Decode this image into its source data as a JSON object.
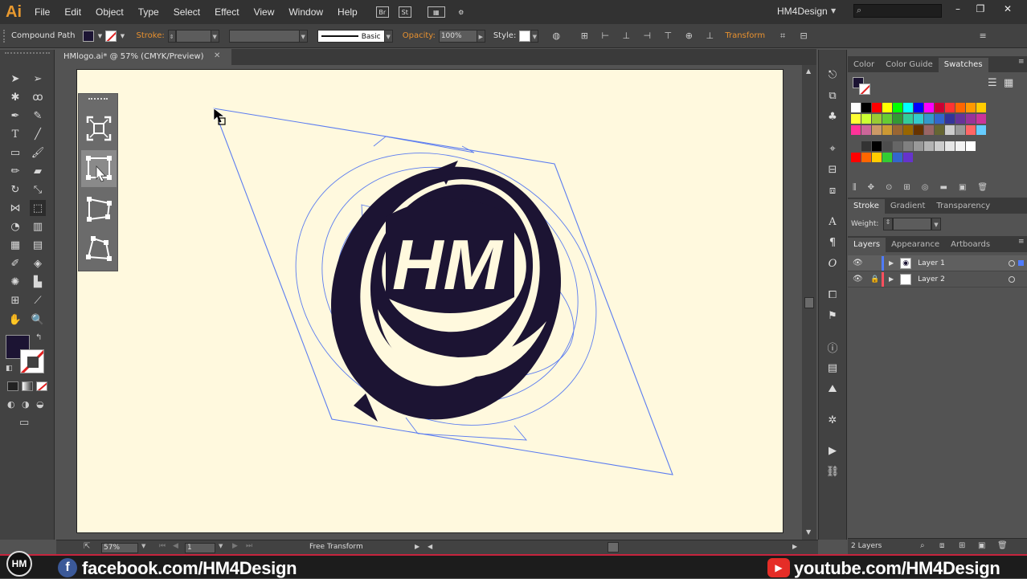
{
  "app": {
    "logo": "Ai"
  },
  "menubar": {
    "items": [
      "File",
      "Edit",
      "Object",
      "Type",
      "Select",
      "Effect",
      "View",
      "Window",
      "Help"
    ],
    "bridge_label": "Br",
    "stock_label": "St",
    "workspace": "HM4Design"
  },
  "controlbar": {
    "selection_type": "Compound Path",
    "stroke_label": "Stroke:",
    "brush_label": "Basic",
    "opacity_label": "Opacity:",
    "opacity_value": "100%",
    "style_label": "Style:",
    "transform_label": "Transform"
  },
  "document": {
    "tab_title": "HMlogo.ai* @ 57% (CMYK/Preview)",
    "logo_text": "HM"
  },
  "statusbar": {
    "zoom": "57%",
    "artboard_number": "1",
    "status_text": "Free Transform"
  },
  "panels": {
    "top_tabs": [
      "Color",
      "Color Guide",
      "Swatches"
    ],
    "stroke_tabs": [
      "Stroke",
      "Gradient",
      "Transparency"
    ],
    "weight_label": "Weight:",
    "layer_tabs": [
      "Layers",
      "Appearance",
      "Artboards"
    ],
    "layers": [
      {
        "name": "Layer 1",
        "color": "#4f7cff"
      },
      {
        "name": "Layer 2",
        "color": "#ff4f5e"
      }
    ],
    "layer_count": "2 Layers"
  },
  "banner": {
    "facebook": "facebook.com/HM4Design",
    "youtube": "youtube.com/HM4Design",
    "badge": "HM"
  },
  "colors": {
    "fill": "#1c1433",
    "accent_orange": "#e8912f",
    "artboard": "#fff9de",
    "selection": "#5b7cf0"
  },
  "swatches": {
    "row1": [
      "#ffffff",
      "#000000",
      "#ff0000",
      "#ffff00",
      "#00ff00",
      "#00ffff",
      "#0000ff",
      "#ff00ff",
      "#cc0033",
      "#ff3333",
      "#ff6600",
      "#ff9900",
      "#ffcc00"
    ],
    "row2": [
      "#ffff33",
      "#ccff33",
      "#99cc33",
      "#66cc33",
      "#339933",
      "#33cc99",
      "#33cccc",
      "#3399cc",
      "#3366cc",
      "#333399",
      "#663399",
      "#993399",
      "#cc3399"
    ],
    "row3": [
      "#ff3399",
      "#cc6699",
      "#cc9966",
      "#cc9933",
      "#996633",
      "#996600",
      "#663300",
      "#996666",
      "#666633",
      "#cccccc",
      "#999999",
      "#ff6666",
      "#66ccff"
    ],
    "row4": [
      "#333333",
      "#000000",
      "#4d4d4d",
      "#666666",
      "#808080",
      "#999999",
      "#b3b3b3",
      "#cccccc",
      "#e6e6e6",
      "#f2f2f2",
      "#ffffff"
    ],
    "row5": [
      "#ff0000",
      "#ff6600",
      "#ffcc00",
      "#33cc33",
      "#3366cc",
      "#6633cc"
    ]
  }
}
